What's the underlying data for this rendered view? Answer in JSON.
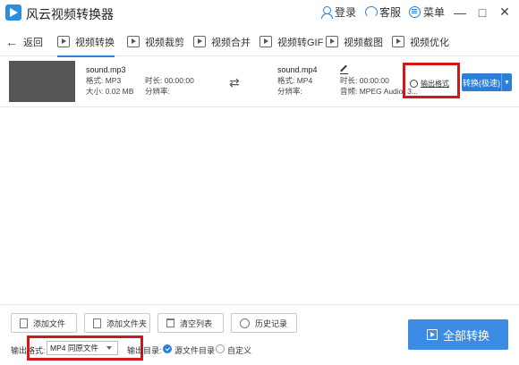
{
  "app": {
    "title": "风云视频转换器"
  },
  "titlebar": {
    "login": "登录",
    "service": "客服",
    "menu": "菜单",
    "minimize": "—",
    "maximize": "□",
    "close": "✕"
  },
  "nav": {
    "back": "返回",
    "items": [
      {
        "label": "视频转换",
        "active": true
      },
      {
        "label": "视频裁剪"
      },
      {
        "label": "视频合并"
      },
      {
        "label": "视频转GIF"
      },
      {
        "label": "视频截图"
      },
      {
        "label": "视频优化"
      }
    ]
  },
  "file": {
    "source": {
      "name": "sound.mp3",
      "format": "格式: MP3",
      "size": "大小: 0.02 MB",
      "duration": "时长: 00:00:00",
      "resolution": "分辨率:"
    },
    "target": {
      "name": "sound.mp4",
      "format": "格式: MP4",
      "duration": "时长: 00:00:00",
      "resolution": "分辨率:",
      "audio": "音频: MPEG Audio, 3..."
    },
    "output_format_link": "输出格式",
    "convert_button": "转换(极速)"
  },
  "bottom": {
    "add_file": "添加文件",
    "add_folder": "添加文件夹",
    "clear_list": "清空列表",
    "history": "历史记录",
    "output_format_label": "输出格式:",
    "output_format_value": "MP4 同原文件",
    "output_dir_label": "输出目录:",
    "dir_option_source": "源文件目录",
    "dir_option_custom": "自定义",
    "convert_all": "全部转换"
  }
}
